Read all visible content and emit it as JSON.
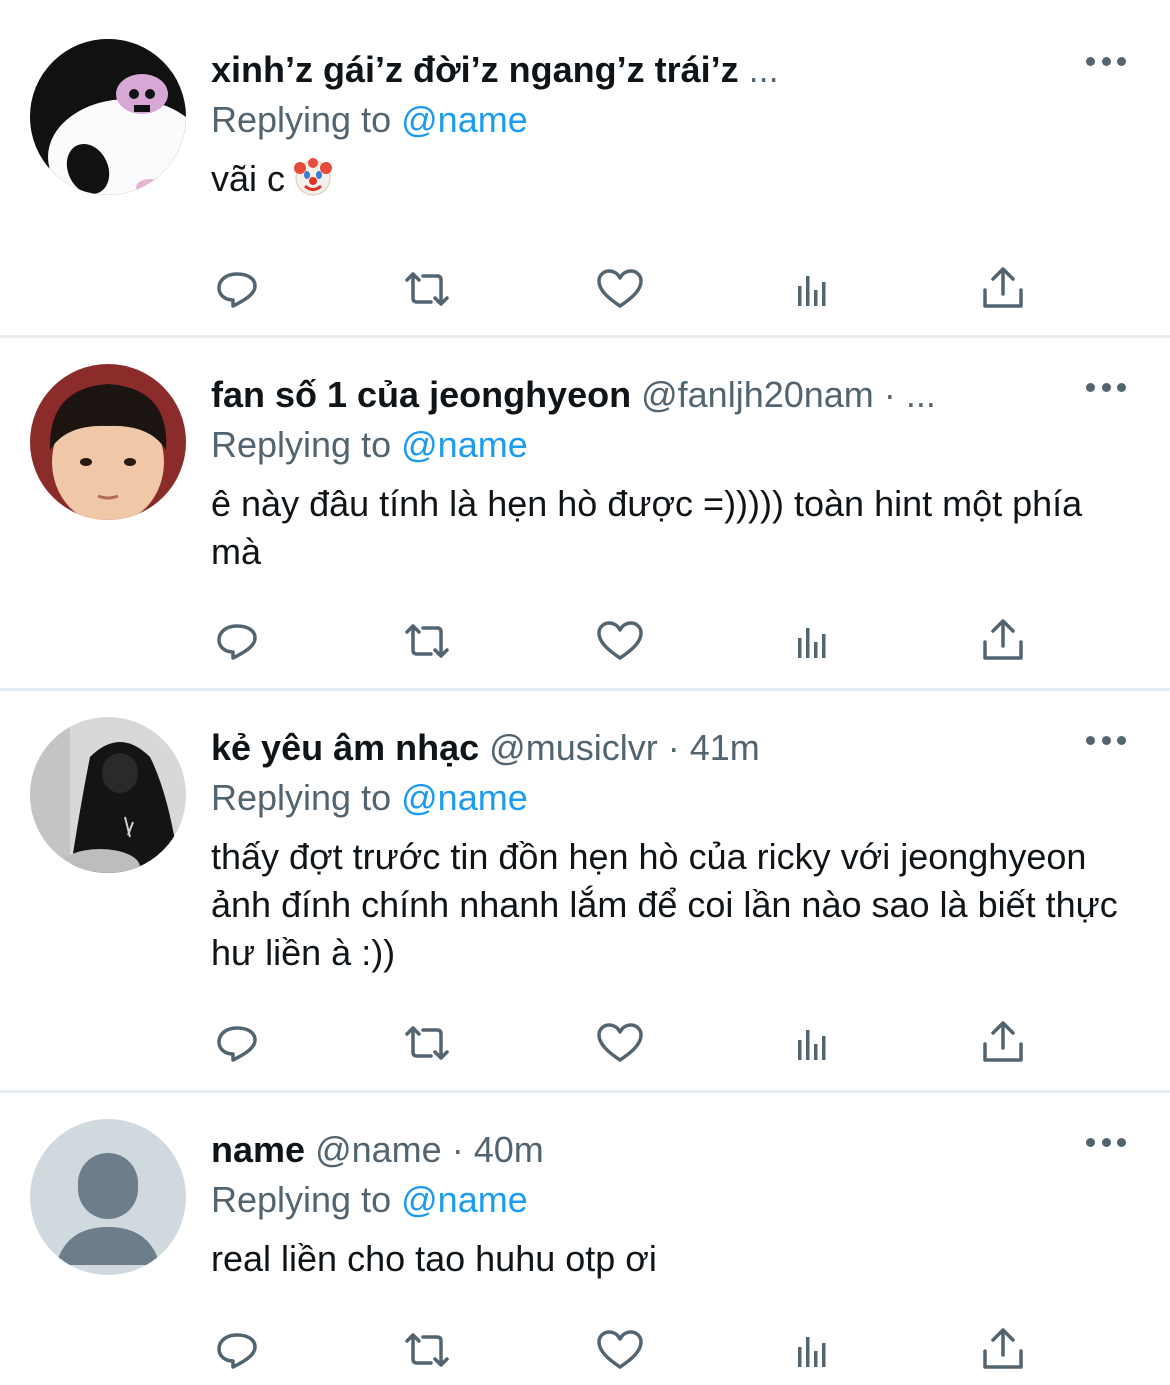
{
  "colors": {
    "accent": "#1d9bf0",
    "secondary_text": "#536471",
    "divider": "#e6ecf0"
  },
  "tweets": [
    {
      "display_name": "xinh’z gái’z đời’z ngang’z trái’z",
      "handle": "",
      "separator": "",
      "time": "",
      "ellipsis": "...",
      "reply_prefix": "Replying to",
      "reply_to": "@name",
      "text": "vãi c",
      "emoji": "clown-face-emoji",
      "avatar": "kuromi-avatar"
    },
    {
      "display_name": "fan số 1 của jeonghyeon",
      "handle": "@fanljh20nam",
      "separator": "·",
      "time": "",
      "ellipsis": "...",
      "reply_prefix": "Replying to",
      "reply_to": "@name",
      "text": "ê này đâu tính là hẹn hò được =))))) toàn hint một phía mà",
      "avatar": "child-photo-avatar"
    },
    {
      "display_name": "kẻ yêu âm nhạc",
      "handle": "@musiclvr",
      "separator": "·",
      "time": "41m",
      "ellipsis": "",
      "reply_prefix": "Replying to",
      "reply_to": "@name",
      "text": "thấy đợt trước tin đồn hẹn hò của ricky với jeonghyeon ảnh đính chính nhanh lắm để coi lần nào sao là biết thực hư liền à :))",
      "avatar": "hooded-person-avatar"
    },
    {
      "display_name": "name",
      "handle": "@name",
      "separator": "·",
      "time": "40m",
      "ellipsis": "",
      "reply_prefix": "Replying to",
      "reply_to": "@name",
      "text": "real liền cho tao huhu otp ơi",
      "avatar": "default-profile-avatar"
    }
  ],
  "actions": [
    "reply-icon",
    "retweet-icon",
    "like-icon",
    "analytics-icon",
    "share-icon"
  ]
}
